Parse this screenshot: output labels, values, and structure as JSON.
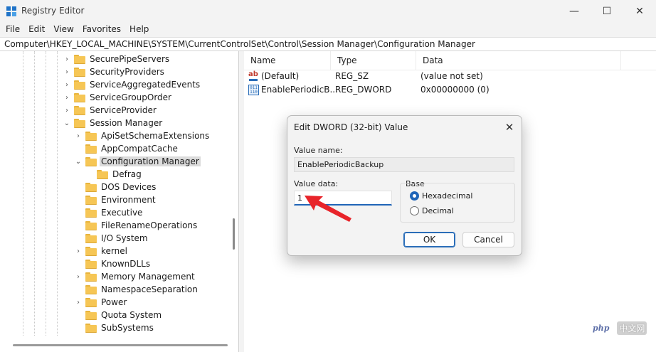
{
  "window": {
    "title": "Registry Editor",
    "minimize_icon": "—",
    "maximize_icon": "☐",
    "close_icon": "✕"
  },
  "menu": [
    "File",
    "Edit",
    "View",
    "Favorites",
    "Help"
  ],
  "address": "Computer\\HKEY_LOCAL_MACHINE\\SYSTEM\\CurrentControlSet\\Control\\Session Manager\\Configuration Manager",
  "tree": {
    "items": [
      {
        "label": "SecurePipeServers",
        "expander": "›"
      },
      {
        "label": "SecurityProviders",
        "expander": "›"
      },
      {
        "label": "ServiceAggregatedEvents",
        "expander": "›"
      },
      {
        "label": "ServiceGroupOrder",
        "expander": "›"
      },
      {
        "label": "ServiceProvider",
        "expander": "›"
      },
      {
        "label": "Session Manager",
        "expander": "⌄"
      },
      {
        "label": "ApiSetSchemaExtensions",
        "expander": "›"
      },
      {
        "label": "AppCompatCache",
        "expander": ""
      },
      {
        "label": "Configuration Manager",
        "expander": "⌄"
      },
      {
        "label": "Defrag",
        "expander": ""
      },
      {
        "label": "DOS Devices",
        "expander": ""
      },
      {
        "label": "Environment",
        "expander": ""
      },
      {
        "label": "Executive",
        "expander": ""
      },
      {
        "label": "FileRenameOperations",
        "expander": ""
      },
      {
        "label": "I/O System",
        "expander": ""
      },
      {
        "label": "kernel",
        "expander": "›"
      },
      {
        "label": "KnownDLLs",
        "expander": ""
      },
      {
        "label": "Memory Management",
        "expander": "›"
      },
      {
        "label": "NamespaceSeparation",
        "expander": ""
      },
      {
        "label": "Power",
        "expander": "›"
      },
      {
        "label": "Quota System",
        "expander": ""
      },
      {
        "label": "SubSystems",
        "expander": ""
      }
    ]
  },
  "values_list": {
    "columns": [
      "Name",
      "Type",
      "Data"
    ],
    "rows": [
      {
        "icon": "string-value-icon",
        "glyph": "ab",
        "name": "(Default)",
        "type": "REG_SZ",
        "data": "(value not set)"
      },
      {
        "icon": "binary-value-icon",
        "glyph": "011\n110",
        "name": "EnablePeriodicB...",
        "type": "REG_DWORD",
        "data": "0x00000000 (0)"
      }
    ]
  },
  "dialog": {
    "title": "Edit DWORD (32-bit) Value",
    "close_icon": "✕",
    "value_name_label": "Value name:",
    "value_name": "EnablePeriodicBackup",
    "value_data_label": "Value data:",
    "value_data": "1",
    "base_label": "Base",
    "base_options": [
      "Hexadecimal",
      "Decimal"
    ],
    "base_selected": "Hexadecimal",
    "ok_label": "OK",
    "cancel_label": "Cancel"
  },
  "watermark": {
    "logo_text": "php",
    "text": "中文网"
  },
  "colors": {
    "accent": "#1f65b8",
    "arrow": "#e8242a",
    "folder": "#f6c655"
  }
}
